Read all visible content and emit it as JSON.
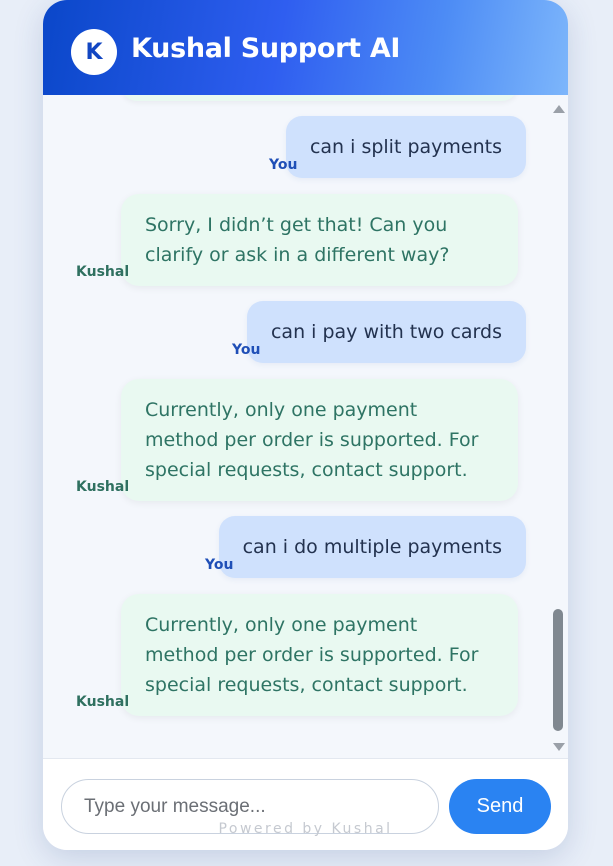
{
  "header": {
    "avatar_letter": "K",
    "title": "Kushal Support AI"
  },
  "messages": [
    {
      "sender": "user",
      "label": "You",
      "text": "can i split payments"
    },
    {
      "sender": "bot",
      "label": "Kushal",
      "text": "Sorry, I didn’t get that! Can you clarify or ask in a different way?"
    },
    {
      "sender": "user",
      "label": "You",
      "text": "can i pay with two cards"
    },
    {
      "sender": "bot",
      "label": "Kushal",
      "text": "Currently, only one payment method per order is supported. For special requests, contact support."
    },
    {
      "sender": "user",
      "label": "You",
      "text": "can i do multiple payments"
    },
    {
      "sender": "bot",
      "label": "Kushal",
      "text": "Currently, only one payment method per order is supported. For special requests, contact support."
    }
  ],
  "composer": {
    "placeholder": "Type your message...",
    "send_label": "Send",
    "powered_by": "Powered by Kushal"
  },
  "colors": {
    "header_start": "#0a47c9",
    "header_end": "#7db6fb",
    "user_bubble": "#cfe1fd",
    "bot_bubble": "#e9f9f1",
    "send_button": "#2a83f2"
  }
}
